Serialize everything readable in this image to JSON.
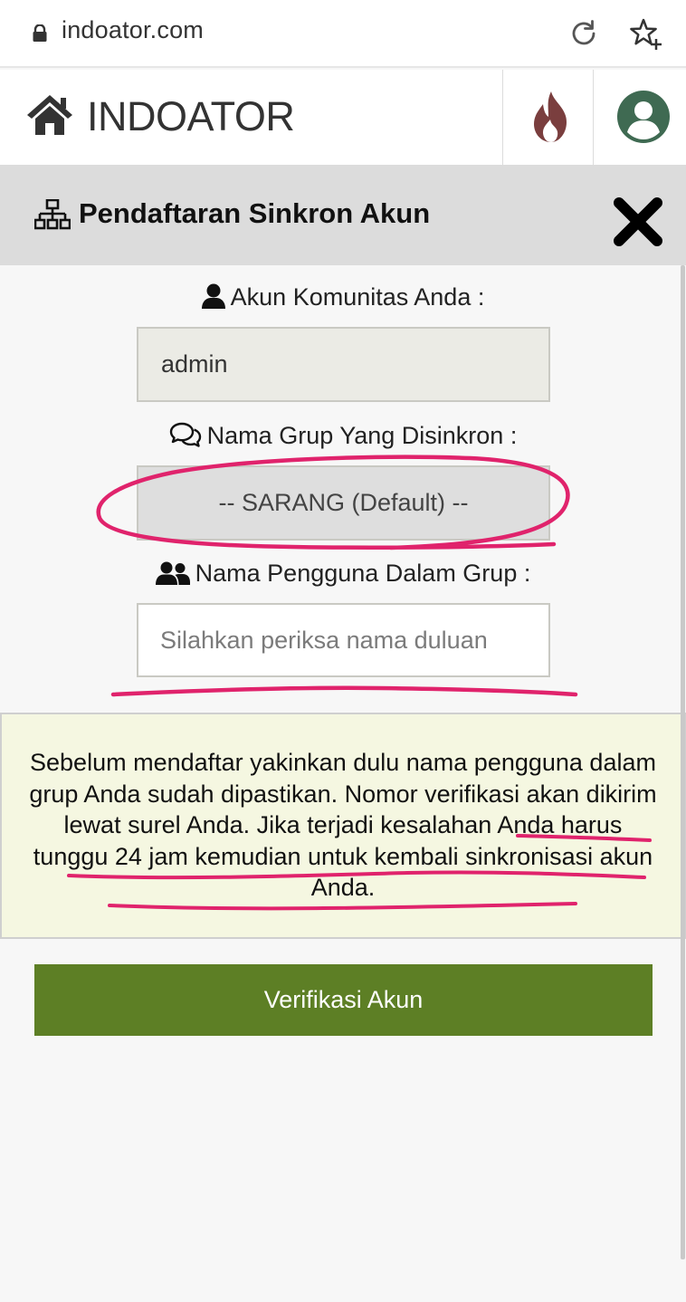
{
  "browser": {
    "url": "indoator.com",
    "icons": {
      "lock": "lock-icon",
      "reload": "reload-icon",
      "bookmark": "star-add-icon"
    }
  },
  "header": {
    "brand": "INDOATOR",
    "icons": {
      "home": "home-icon",
      "trending": "fire-icon",
      "account": "user-circle-icon"
    },
    "colors": {
      "fire": "#7a3e3e",
      "account": "#3f6a52"
    }
  },
  "panel": {
    "title": "Pendaftaran Sinkron Akun",
    "title_icon": "sitemap-icon",
    "close_icon": "close-icon"
  },
  "form": {
    "community_account": {
      "label": "Akun Komunitas Anda :",
      "value": "admin",
      "icon": "user-icon"
    },
    "group": {
      "label": "Nama Grup Yang Disinkron :",
      "selected": "-- SARANG (Default) --",
      "icon": "comments-icon"
    },
    "group_username": {
      "label": "Nama Pengguna Dalam Grup :",
      "placeholder": "Silahkan periksa nama duluan",
      "value": "",
      "icon": "users-icon"
    }
  },
  "notice": {
    "text": "Sebelum mendaftar yakinkan dulu nama pengguna dalam grup Anda sudah dipastikan. Nomor verifikasi akan dikirim lewat surel Anda. Jika terjadi kesalahan Anda harus tunggu 24 jam kemudian untuk kembali sinkronisasi akun Anda."
  },
  "actions": {
    "verify_label": "Verifikasi Akun"
  },
  "colors": {
    "accent_button": "#5d7f25",
    "notice_background": "#f5f7e1",
    "panel_header": "#dcdcdc",
    "annotation": "#e0236c"
  }
}
